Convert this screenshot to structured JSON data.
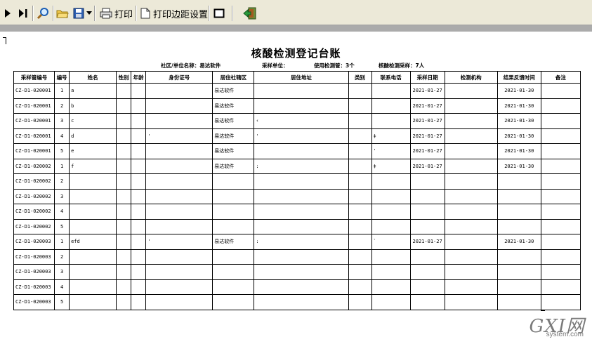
{
  "toolbar": {
    "print_label": "打印",
    "margin_label": "打印边距设置"
  },
  "report": {
    "title": "核酸检测登记台账",
    "community_label": "社区/单位名称：",
    "community_value": "易达软件",
    "unit_label": "采样单位：",
    "unit_value": "",
    "tubes_label": "使用检测管：",
    "tubes_value": "3个",
    "people_label": "核酸检测采样：",
    "people_value": "7人"
  },
  "table": {
    "headers": [
      "采样管编号",
      "编号",
      "姓名",
      "性别",
      "年龄",
      "身份证号",
      "居住社辖区",
      "居住地址",
      "类别",
      "联系电话",
      "采样日期",
      "检测机构",
      "结果反馈时间",
      "备注"
    ],
    "rows": [
      [
        "CZ-D1-020001",
        "1",
        "a",
        "",
        "",
        "",
        "易达软件",
        "",
        "",
        "",
        "2021-01-27",
        "",
        "2021-01-30",
        ""
      ],
      [
        "CZ-D1-020001",
        "2",
        "b",
        "",
        "",
        "",
        "易达软件",
        "",
        "",
        "",
        "2021-01-27",
        "",
        "2021-01-30",
        ""
      ],
      [
        "CZ-D1-020001",
        "3",
        "c",
        "",
        "",
        "",
        "易达软件",
        "‹",
        "",
        "",
        "2021-01-27",
        "",
        "2021-01-30",
        ""
      ],
      [
        "CZ-D1-020001",
        "4",
        "d",
        "",
        "",
        "'",
        "易达软件",
        "'",
        "",
        "‡",
        "2021-01-27",
        "",
        "2021-01-30",
        ""
      ],
      [
        "CZ-D1-020001",
        "5",
        "e",
        "",
        "",
        "",
        "易达软件",
        "",
        "",
        "'",
        "2021-01-27",
        "",
        "2021-01-30",
        ""
      ],
      [
        "CZ-D1-020002",
        "1",
        "f",
        "",
        "",
        "",
        "易达软件",
        ":",
        "",
        "‡",
        "2021-01-27",
        "",
        "2021-01-30",
        ""
      ],
      [
        "CZ-D1-020002",
        "2",
        "",
        "",
        "",
        "",
        "",
        "",
        "",
        "",
        "",
        "",
        "",
        ""
      ],
      [
        "CZ-D1-020002",
        "3",
        "",
        "",
        "",
        "",
        "",
        "",
        "",
        "",
        "",
        "",
        "",
        ""
      ],
      [
        "CZ-D1-020002",
        "4",
        "",
        "",
        "",
        "",
        "",
        "",
        "",
        "",
        "",
        "",
        "",
        ""
      ],
      [
        "CZ-D1-020002",
        "5",
        "",
        "",
        "",
        "",
        "",
        "",
        "",
        "",
        "",
        "",
        "",
        ""
      ],
      [
        "CZ-D1-020003",
        "1",
        "efd",
        "",
        "",
        "'",
        "易达软件",
        ":",
        "",
        "`",
        "2021-01-27",
        "",
        "2021-01-30",
        ""
      ],
      [
        "CZ-D1-020003",
        "2",
        "",
        "",
        "",
        "",
        "",
        "",
        "",
        "",
        "",
        "",
        "",
        ""
      ],
      [
        "CZ-D1-020003",
        "3",
        "",
        "",
        "",
        "",
        "",
        "",
        "",
        "",
        "",
        "",
        "",
        ""
      ],
      [
        "CZ-D1-020003",
        "4",
        "",
        "",
        "",
        "",
        "",
        "",
        "",
        "",
        "",
        "",
        "",
        ""
      ],
      [
        "CZ-D1-020003",
        "5",
        "",
        "",
        "",
        "",
        "",
        "",
        "",
        "",
        "",
        "",
        "",
        ""
      ]
    ]
  },
  "watermark": {
    "brand": "GXI网",
    "domain": "system.com"
  }
}
